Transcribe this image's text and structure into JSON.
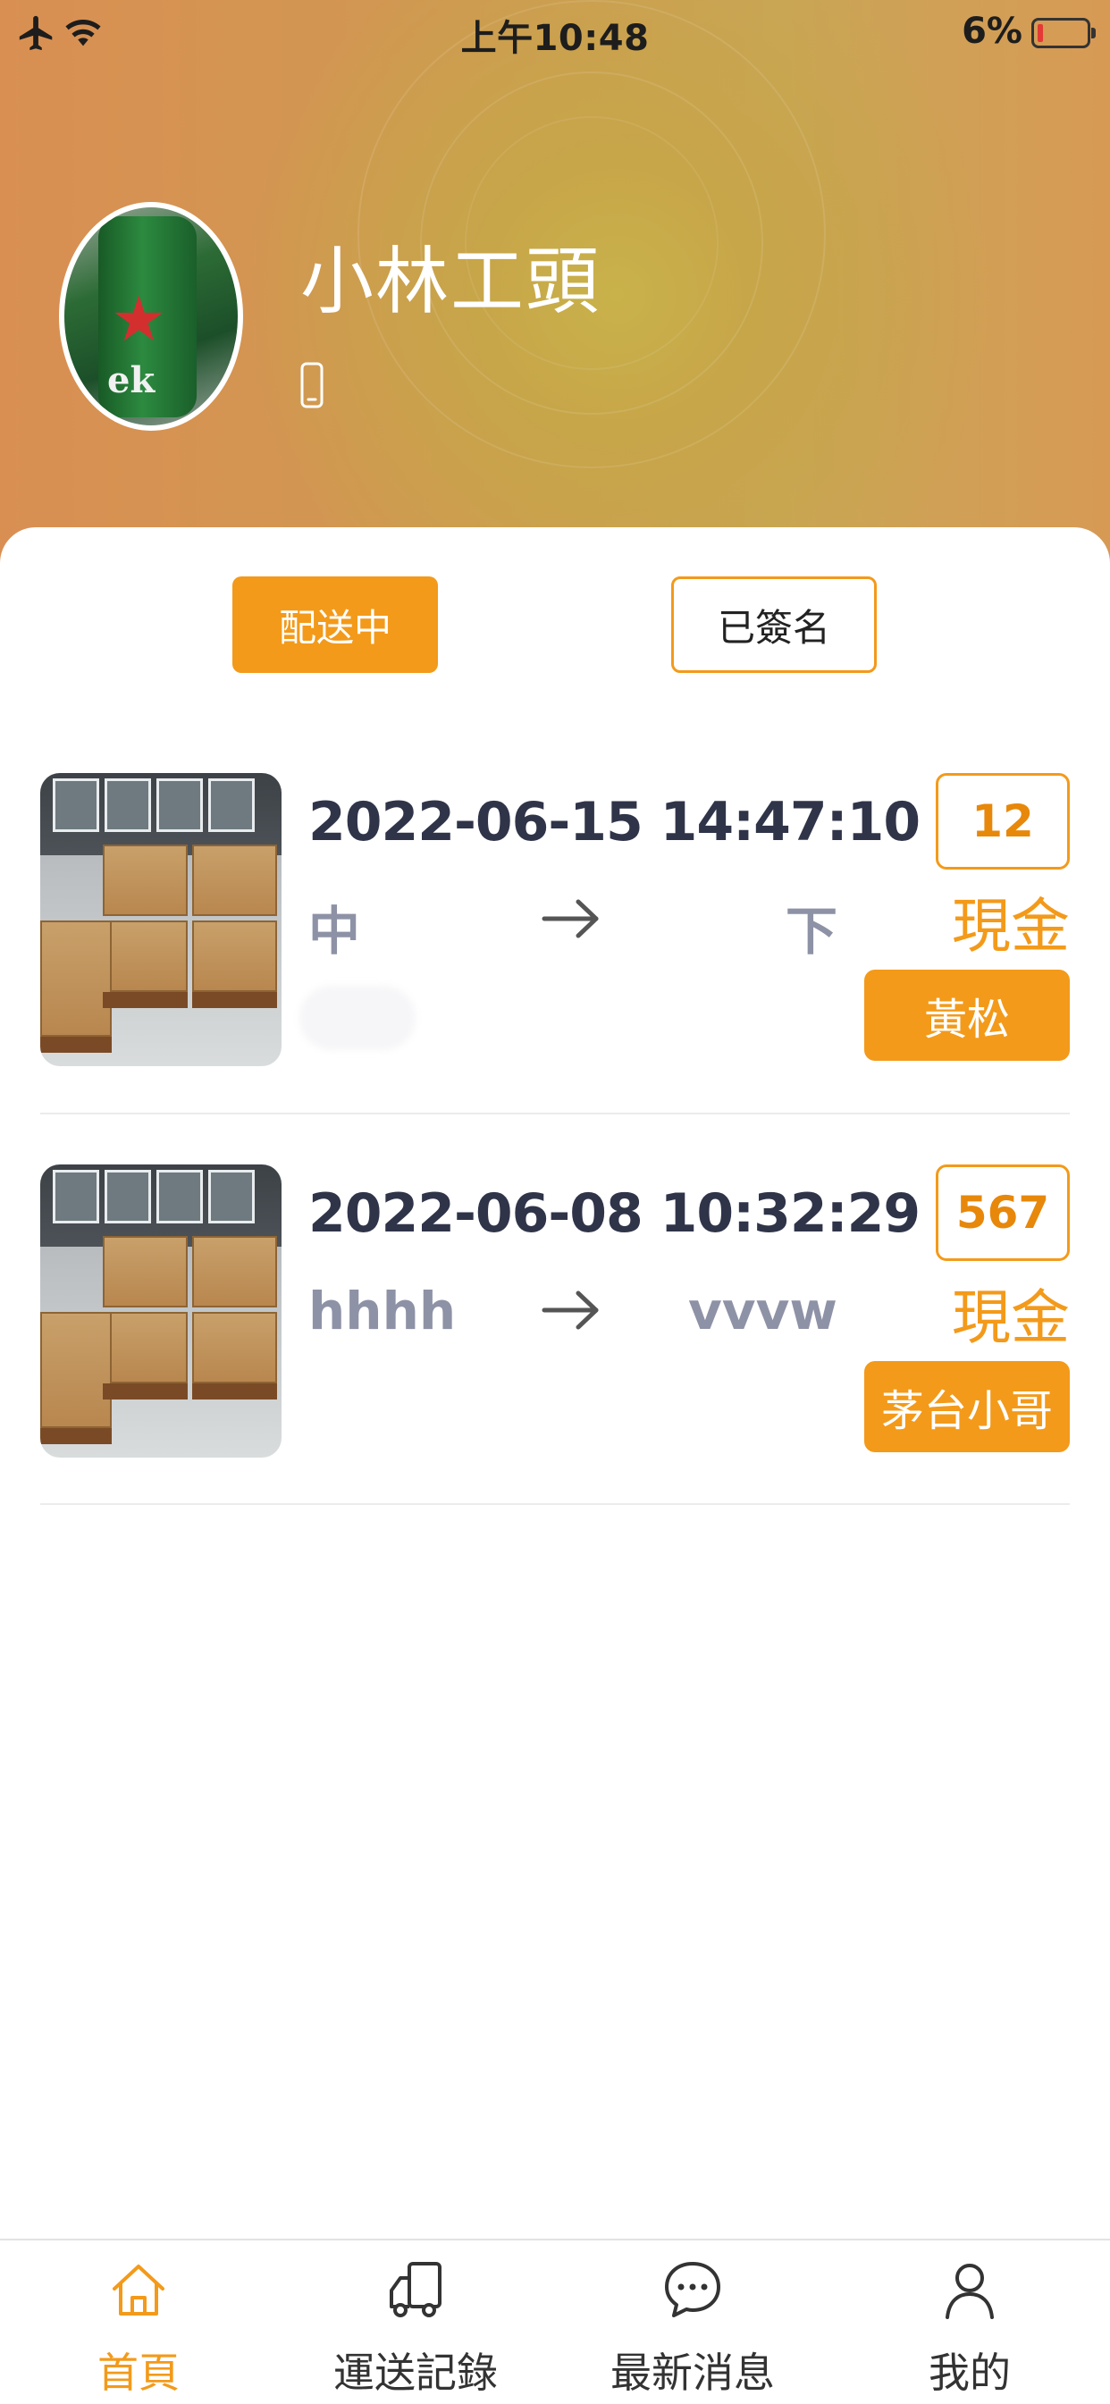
{
  "status_bar": {
    "time": "上午10:48",
    "battery_percent": "6%",
    "icons": [
      "airplane-icon",
      "wifi-icon",
      "battery-icon"
    ]
  },
  "profile": {
    "name": "小林工頭",
    "avatar": "avatar-image",
    "phone_icon": "phone-icon"
  },
  "segments": {
    "active_label": "配送中",
    "inactive_label": "已簽名"
  },
  "orders": [
    {
      "time": "2022-06-15 14:47:10",
      "from": "中",
      "to": "下",
      "quantity": "12",
      "payment": "現金",
      "driver": "黃松"
    },
    {
      "time": "2022-06-08 10:32:29",
      "from": "hhhh",
      "to": "vvvw",
      "quantity": "567",
      "payment": "現金",
      "driver": "茅台小哥"
    }
  ],
  "tabbar": {
    "items": [
      {
        "label": "首頁",
        "icon": "home-icon",
        "active": true
      },
      {
        "label": "運送記錄",
        "icon": "truck-icon",
        "active": false
      },
      {
        "label": "最新消息",
        "icon": "chat-bubble-icon",
        "active": false
      },
      {
        "label": "我的",
        "icon": "user-icon",
        "active": false
      }
    ]
  },
  "colors": {
    "accent": "#f39a1a",
    "text_dark": "#2f3449",
    "text_muted": "#8e92a6"
  }
}
